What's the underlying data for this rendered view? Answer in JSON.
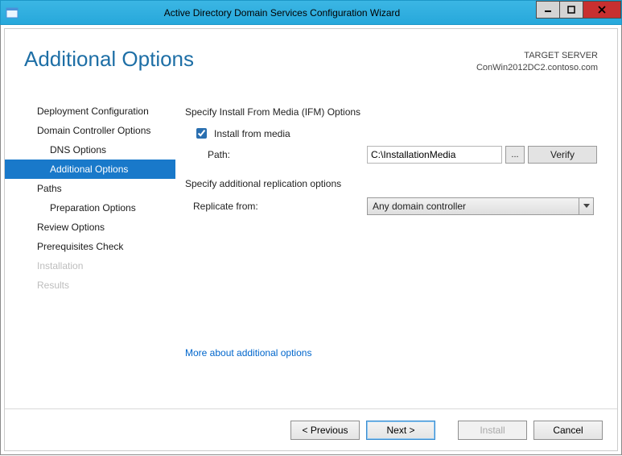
{
  "window": {
    "title": "Active Directory Domain Services Configuration Wizard"
  },
  "header": {
    "heading": "Additional Options",
    "target_label": "TARGET SERVER",
    "target_value": "ConWin2012DC2.contoso.com"
  },
  "sidebar": {
    "steps": [
      {
        "label": "Deployment Configuration",
        "sub": false,
        "selected": false,
        "disabled": false
      },
      {
        "label": "Domain Controller Options",
        "sub": false,
        "selected": false,
        "disabled": false
      },
      {
        "label": "DNS Options",
        "sub": true,
        "selected": false,
        "disabled": false
      },
      {
        "label": "Additional Options",
        "sub": true,
        "selected": true,
        "disabled": false
      },
      {
        "label": "Paths",
        "sub": false,
        "selected": false,
        "disabled": false
      },
      {
        "label": "Preparation Options",
        "sub": true,
        "selected": false,
        "disabled": false
      },
      {
        "label": "Review Options",
        "sub": false,
        "selected": false,
        "disabled": false
      },
      {
        "label": "Prerequisites Check",
        "sub": false,
        "selected": false,
        "disabled": false
      },
      {
        "label": "Installation",
        "sub": false,
        "selected": false,
        "disabled": true
      },
      {
        "label": "Results",
        "sub": false,
        "selected": false,
        "disabled": true
      }
    ]
  },
  "main": {
    "ifm_section": "Specify Install From Media (IFM) Options",
    "ifm_checkbox_label": "Install from media",
    "path_label": "Path:",
    "path_value": "C:\\InstallationMedia",
    "browse_label": "...",
    "verify_label": "Verify",
    "rep_section": "Specify additional replication options",
    "rep_label": "Replicate from:",
    "rep_value": "Any domain controller",
    "more_link": "More about additional options"
  },
  "footer": {
    "previous": "< Previous",
    "next": "Next >",
    "install": "Install",
    "cancel": "Cancel"
  },
  "colors": {
    "accent": "#1979ca",
    "heading": "#1e6fa6",
    "titlebar": "#27a8db"
  }
}
